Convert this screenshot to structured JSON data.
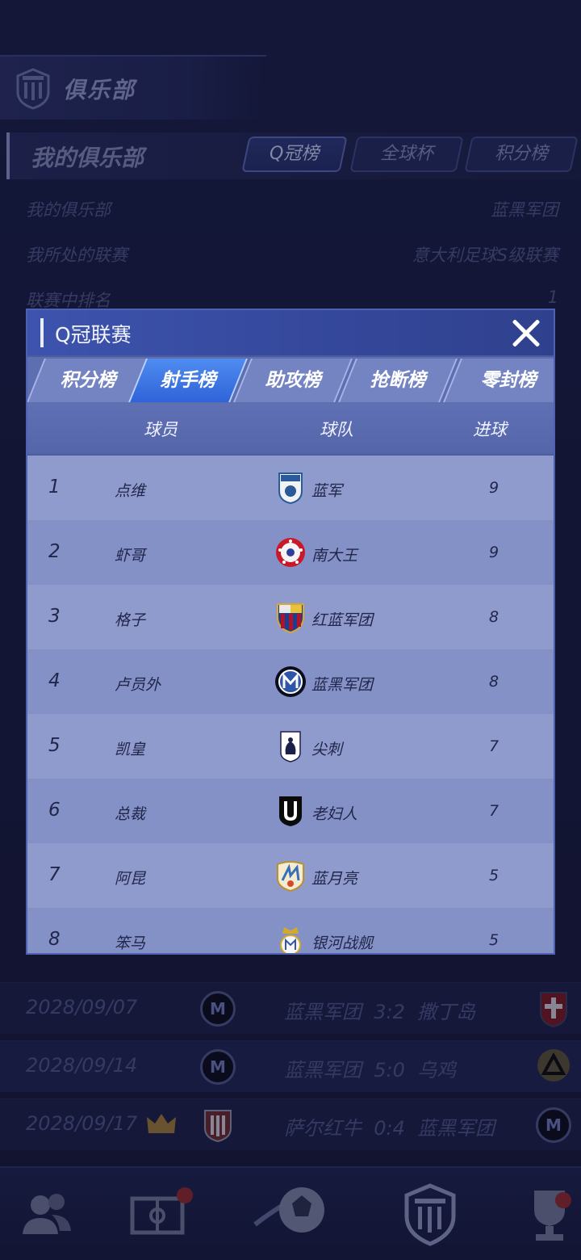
{
  "background": {
    "club_header": {
      "title": "俱乐部"
    },
    "my_club": {
      "title": "我的俱乐部",
      "tabs": [
        {
          "label": "Q冠榜",
          "active": true
        },
        {
          "label": "全球杯",
          "active": false
        },
        {
          "label": "积分榜",
          "active": false
        }
      ]
    },
    "info": [
      {
        "label": "我的俱乐部",
        "value": "蓝黑军团"
      },
      {
        "label": "我所处的联赛",
        "value": "意大利足球S级联赛"
      },
      {
        "label": "联赛中排名",
        "value": "1"
      }
    ],
    "matches": [
      {
        "date": "2028/09/07",
        "home": "蓝黑军团",
        "score": "3:2",
        "away": "撒丁岛"
      },
      {
        "date": "2028/09/14",
        "home": "蓝黑军团",
        "score": "5:0",
        "away": "乌鸡"
      },
      {
        "date": "2028/09/17",
        "home": "萨尔红牛",
        "score": "0:4",
        "away": "蓝黑军团"
      }
    ]
  },
  "modal": {
    "title": "Q冠联赛",
    "tabs": [
      {
        "label": "积分榜",
        "active": false
      },
      {
        "label": "射手榜",
        "active": true
      },
      {
        "label": "助攻榜",
        "active": false
      },
      {
        "label": "抢断榜",
        "active": false
      },
      {
        "label": "零封榜",
        "active": false
      }
    ],
    "columns": {
      "player": "球员",
      "team": "球队",
      "goals": "进球"
    },
    "rows": [
      {
        "rank": "1",
        "player": "点维",
        "team": "蓝军",
        "goals": "9",
        "crest": "qex-crest-icon"
      },
      {
        "rank": "2",
        "player": "虾哥",
        "team": "南大王",
        "goals": "9",
        "crest": "star-ball-crest-icon"
      },
      {
        "rank": "3",
        "player": "格子",
        "team": "红蓝军团",
        "goals": "8",
        "crest": "striped-shield-crest-icon"
      },
      {
        "rank": "4",
        "player": "卢员外",
        "team": "蓝黑军团",
        "goals": "8",
        "crest": "inter-m-crest-icon"
      },
      {
        "rank": "5",
        "player": "凯皇",
        "team": "尖刺",
        "goals": "7",
        "crest": "rooster-crest-icon"
      },
      {
        "rank": "6",
        "player": "总裁",
        "team": "老妇人",
        "goals": "7",
        "crest": "j-shield-crest-icon"
      },
      {
        "rank": "7",
        "player": "阿昆",
        "team": "蓝月亮",
        "goals": "5",
        "crest": "sun-shield-crest-icon"
      },
      {
        "rank": "8",
        "player": "笨马",
        "team": "银河战舰",
        "goals": "5",
        "crest": "crown-crest-icon"
      }
    ]
  },
  "colors": {
    "accent_tab": "#3a72e6",
    "modal_header": "#3d53ad",
    "row_light": "#8f9bcc",
    "row_dark": "#8491c6"
  }
}
